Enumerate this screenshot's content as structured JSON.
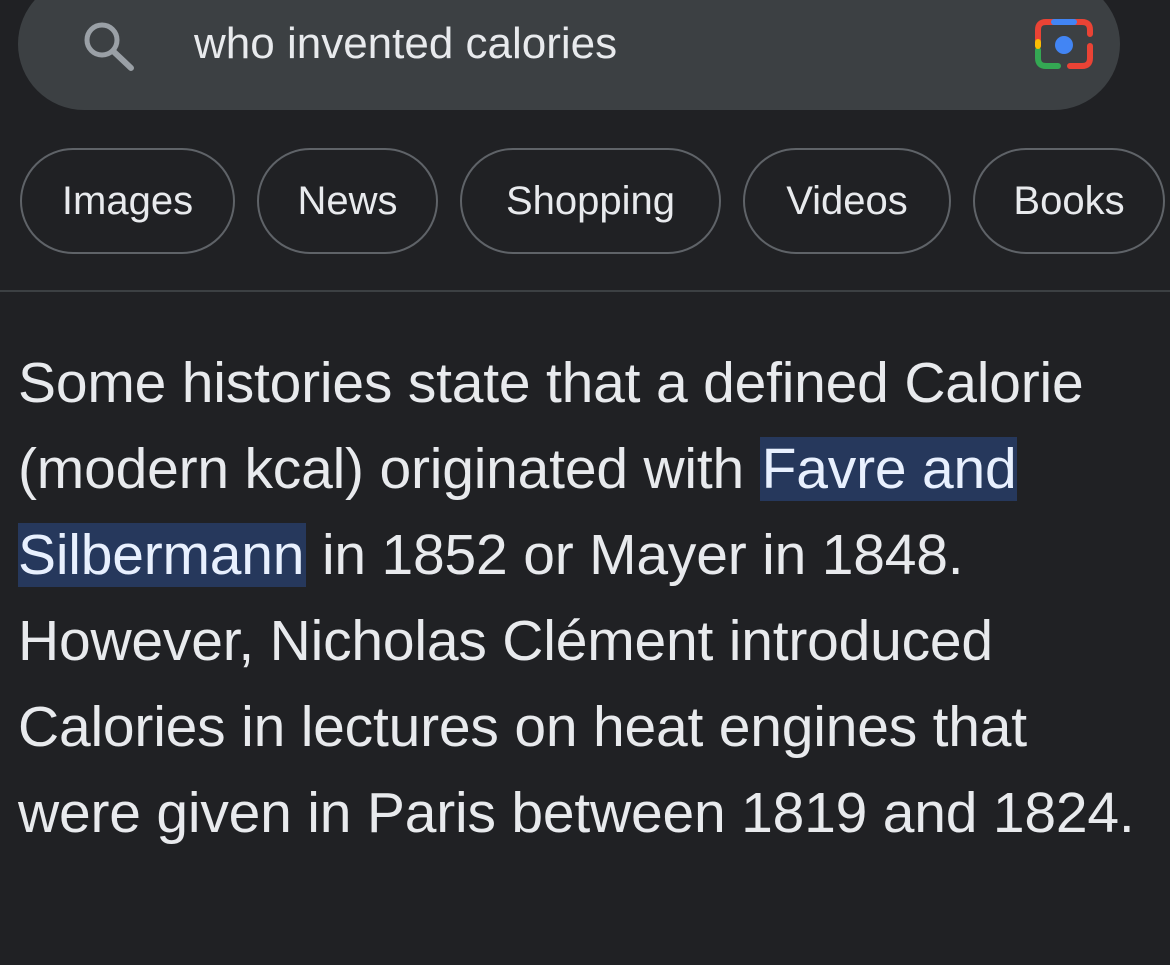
{
  "search": {
    "query": "who invented calories",
    "search_icon": "search-icon",
    "lens_icon": "google-lens-icon"
  },
  "chips": [
    {
      "label": "Images"
    },
    {
      "label": "News"
    },
    {
      "label": "Shopping"
    },
    {
      "label": "Videos"
    },
    {
      "label": "Books"
    }
  ],
  "answer": {
    "text_before": "Some histories state that a defined Calorie (modern kcal) originated with",
    "highlight": "Favre and Silbermann",
    "text_after": "in 1852 or Mayer in 1848. However, Nicholas Clément introduced Calories in lectures on heat engines that were given in Paris between 1819 and 1824."
  },
  "colors": {
    "background": "#202124",
    "search_bar": "#3c4043",
    "text": "#e8eaed",
    "highlight_bg": "#26385c",
    "chip_border": "#5f6368"
  }
}
